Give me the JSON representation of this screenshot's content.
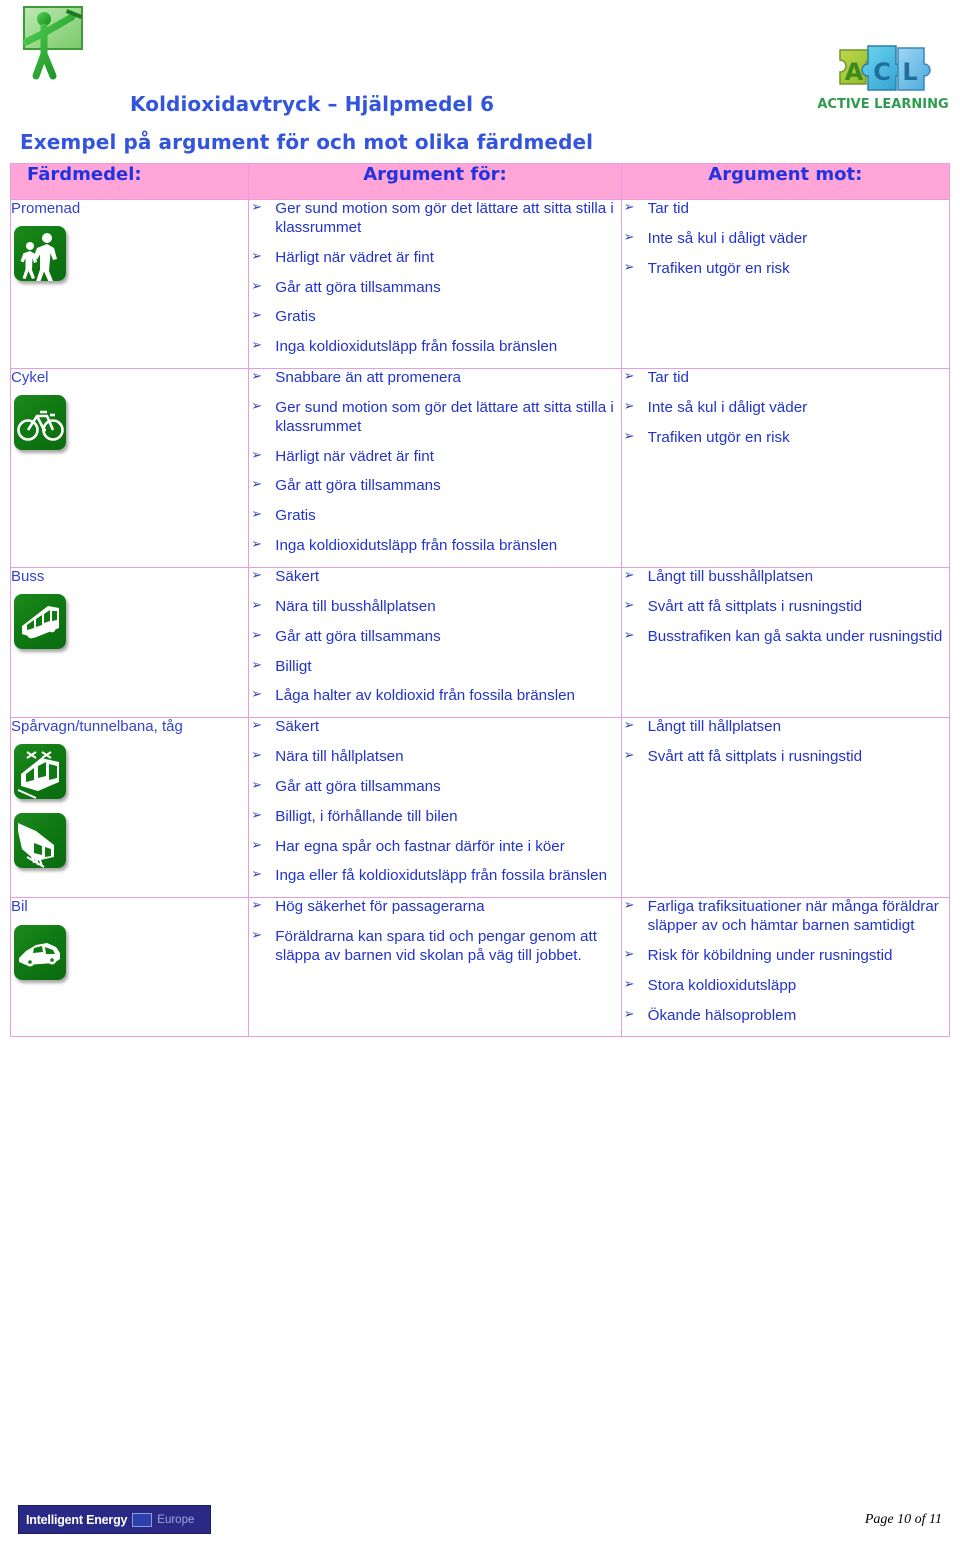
{
  "header": {
    "teacher_logo_alt": "teacher-pointing-at-board",
    "acl_logo_text": "ACTIVE LEARNING",
    "acl_logo_letters": "ACL"
  },
  "title": {
    "main": "Koldioxidavtryck – Hjälpmedel 6",
    "sub": "Exempel på argument för och mot olika färdmedel"
  },
  "table": {
    "columns": [
      "Färdmedel:",
      "Argument för:",
      "Argument mot:"
    ],
    "header_bg": "#ffa5d8",
    "border_color": "#e79ede",
    "text_color": "#2233cc",
    "rows": [
      {
        "mode": "Promenad",
        "icons": [
          "pedestrian-icon"
        ],
        "for": [
          "Ger sund motion som gör det lättare att sitta stilla i klassrummet",
          "Härligt när vädret är fint",
          "Går att göra tillsammans",
          "Gratis",
          "Inga koldioxidutsläpp från fossila bränslen"
        ],
        "against": [
          "Tar tid",
          "Inte så kul i dåligt väder",
          "Trafiken utgör en risk"
        ]
      },
      {
        "mode": "Cykel",
        "icons": [
          "bicycle-icon"
        ],
        "for": [
          "Snabbare än att promenera",
          "Ger sund motion som gör det lättare att sitta stilla i klassrummet",
          "Härligt när vädret är fint",
          "Går att göra tillsammans",
          "Gratis",
          "Inga koldioxidutsläpp från fossila bränslen"
        ],
        "against": [
          "Tar tid",
          "Inte så kul i dåligt väder",
          "Trafiken utgör en risk"
        ]
      },
      {
        "mode": "Buss",
        "icons": [
          "bus-icon"
        ],
        "for": [
          "Säkert",
          "Nära till busshållplatsen",
          "Går att göra tillsammans",
          "Billigt",
          "Låga halter av koldioxid från fossila bränslen"
        ],
        "against": [
          "Långt till busshållplatsen",
          "Svårt att få sittplats i rusningstid",
          "Busstrafiken kan gå sakta under rusningstid"
        ]
      },
      {
        "mode": "Spårvagn/tunnelbana, tåg",
        "icons": [
          "tram-icon",
          "train-icon"
        ],
        "for": [
          "Säkert",
          "Nära till hållplatsen",
          "Går att göra tillsammans",
          "Billigt, i förhållande till bilen",
          "Har egna spår och fastnar därför inte i köer",
          "Inga eller få koldioxidutsläpp från fossila bränslen"
        ],
        "against": [
          "Långt till hållplatsen",
          "Svårt att få sittplats i rusningstid"
        ]
      },
      {
        "mode": "Bil",
        "icons": [
          "car-icon"
        ],
        "for": [
          "Hög säkerhet för passagerarna",
          "Föräldrarna kan spara tid och pengar genom att släppa av barnen vid skolan på väg till jobbet."
        ],
        "against": [
          "Farliga trafiksituationer när många föräldrar släpper av och hämtar barnen samtidigt",
          "Risk för köbildning under rusningstid",
          "Stora koldioxidutsläpp",
          "Ökande hälsoproblem"
        ]
      }
    ]
  },
  "footer": {
    "logo_primary": "Intelligent Energy",
    "logo_secondary": "Europe",
    "page_label": "Page 10 of 11"
  }
}
